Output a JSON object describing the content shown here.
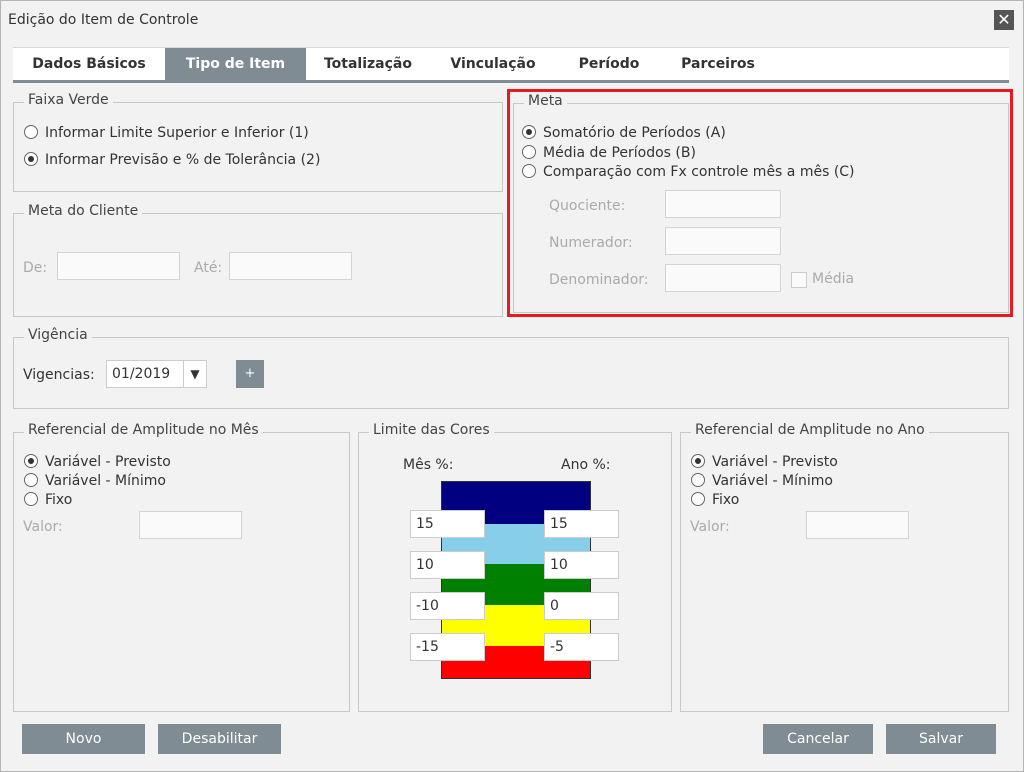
{
  "window": {
    "title": "Edição do Item de Controle"
  },
  "tabs": [
    {
      "label": "Dados Básicos"
    },
    {
      "label": "Tipo de Item"
    },
    {
      "label": "Totalização"
    },
    {
      "label": "Vinculação"
    },
    {
      "label": "Período"
    },
    {
      "label": "Parceiros"
    }
  ],
  "faixa_verde": {
    "legend": "Faixa Verde",
    "opt1": "Informar Limite Superior e Inferior (1)",
    "opt2": "Informar Previsão e % de Tolerância (2)",
    "selected": 2
  },
  "meta_cliente": {
    "legend": "Meta do Cliente",
    "de_label": "De:",
    "ate_label": "Até:"
  },
  "meta": {
    "legend": "Meta",
    "opt_a": "Somatório de Períodos (A)",
    "opt_b": "Média de Períodos (B)",
    "opt_c": "Comparação com Fx controle mês a mês (C)",
    "selected": "A",
    "quociente_label": "Quociente:",
    "numerador_label": "Numerador:",
    "denominador_label": "Denominador:",
    "media_label": "Média"
  },
  "vigencia": {
    "legend": "Vigência",
    "label": "Vigencias:",
    "value": "01/2019",
    "add_label": "+"
  },
  "ref_mes": {
    "legend": "Referencial de Amplitude no Mês",
    "opt1": "Variável - Previsto",
    "opt2": "Variável - Mínimo",
    "opt3": "Fixo",
    "selected": 1,
    "valor_label": "Valor:"
  },
  "limite_cores": {
    "legend": "Limite das Cores",
    "mes_label": "Mês %:",
    "ano_label": "Ano %:",
    "bands": [
      {
        "color": "#000080"
      },
      {
        "color": "#87ceeb"
      },
      {
        "color": "#008000"
      },
      {
        "color": "#ffff00"
      },
      {
        "color": "#ff0000"
      }
    ],
    "mes_values": [
      "15",
      "10",
      "-10",
      "-15"
    ],
    "ano_values": [
      "15",
      "10",
      "0",
      "-5"
    ]
  },
  "ref_ano": {
    "legend": "Referencial de Amplitude no Ano",
    "opt1": "Variável - Previsto",
    "opt2": "Variável - Mínimo",
    "opt3": "Fixo",
    "selected": 1,
    "valor_label": "Valor:"
  },
  "footer": {
    "novo": "Novo",
    "desabilitar": "Desabilitar",
    "cancelar": "Cancelar",
    "salvar": "Salvar"
  }
}
